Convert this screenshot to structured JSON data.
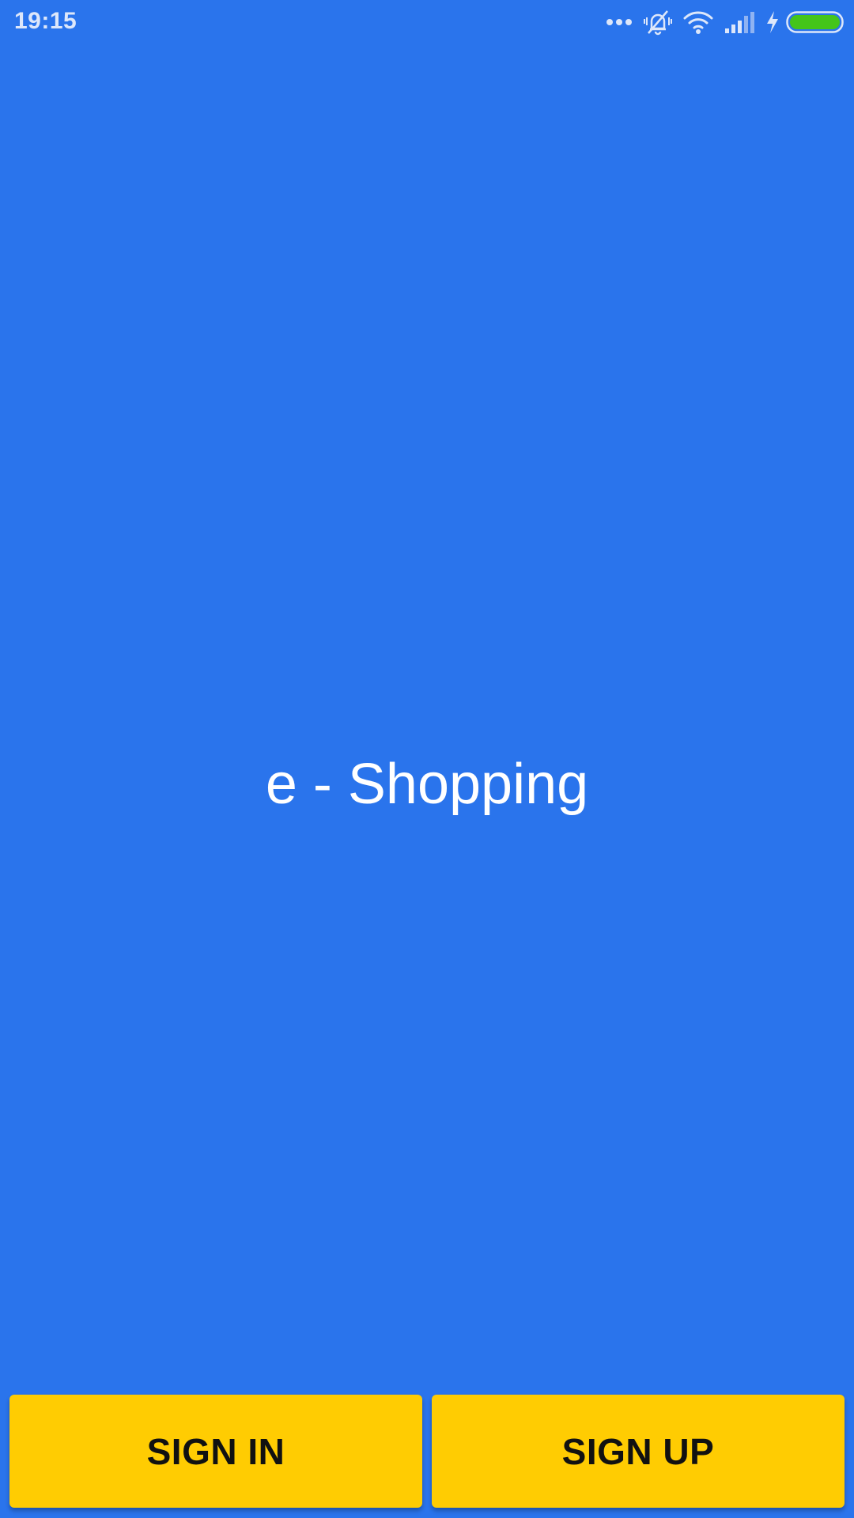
{
  "status_bar": {
    "time": "19:15",
    "icons": [
      "more-dots-icon",
      "bell-off-icon",
      "wifi-icon",
      "signal-icon",
      "charging-icon",
      "battery-icon"
    ]
  },
  "app": {
    "title": "e - Shopping"
  },
  "actions": {
    "sign_in_label": "SIGN IN",
    "sign_up_label": "SIGN UP"
  },
  "colors": {
    "background": "#2A74EC",
    "button": "#FFCC02",
    "battery": "#44C51A"
  }
}
